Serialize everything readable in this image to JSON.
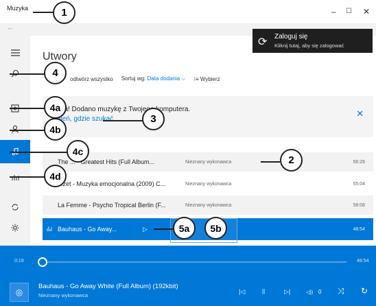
{
  "window": {
    "title": "Muzyka",
    "minimize": "–",
    "maximize": "☐",
    "close": "✕"
  },
  "nav": {
    "back_icon": "←"
  },
  "login": {
    "title": "Zaloguj się",
    "subtitle": "Kliknij tutaj, aby się zalogować",
    "icon": "⟳"
  },
  "page_title": "Utwory",
  "toolbar": {
    "play_all": "odtwórz wszystko",
    "sort_label": "Sortuj wg:",
    "sort_value": "Data dodania ⌵",
    "select_icon": "⁝≡",
    "select_label": "Wybierz"
  },
  "notification": {
    "text": "Hurra! Dodano muzykę z Twojego komputera.",
    "link": "Zmień, gdzie szukać",
    "close": "✕"
  },
  "songs": [
    {
      "title": "The ... - Greatest Hits (Full Album...",
      "artist": "Nieznany wykonawca",
      "duration": "56:26"
    },
    {
      "title": "...zet - Muzyka emocjonalna (2009) C...",
      "artist": "Nieznany wykonawca",
      "duration": "55:04"
    },
    {
      "title": "La Femme - Psycho Tropical Berlin (F...",
      "artist": "Nieznany wykonawca",
      "duration": "58:08"
    },
    {
      "title": "Bauhaus - Go Away...",
      "artist": "",
      "duration": "48:54"
    }
  ],
  "player": {
    "current_time": "0:19",
    "total_time": "48:54",
    "track": "Bauhaus - Go Away White (Full Album) (192kbit)",
    "artist": "Nieznany wykonawca",
    "volume": "0",
    "controls": {
      "prev": "|◁",
      "pause": "||",
      "next": "▷|",
      "volume_icon": "◁))",
      "shuffle": "⤨",
      "repeat": "↻"
    }
  },
  "callouts": [
    "1",
    "2",
    "3",
    "4",
    "4a",
    "4b",
    "4c",
    "4d",
    "5a",
    "5b"
  ],
  "colors": {
    "accent": "#0078d7",
    "sidebar": "#f2f2f2",
    "login_banner": "#1f1f1f"
  }
}
